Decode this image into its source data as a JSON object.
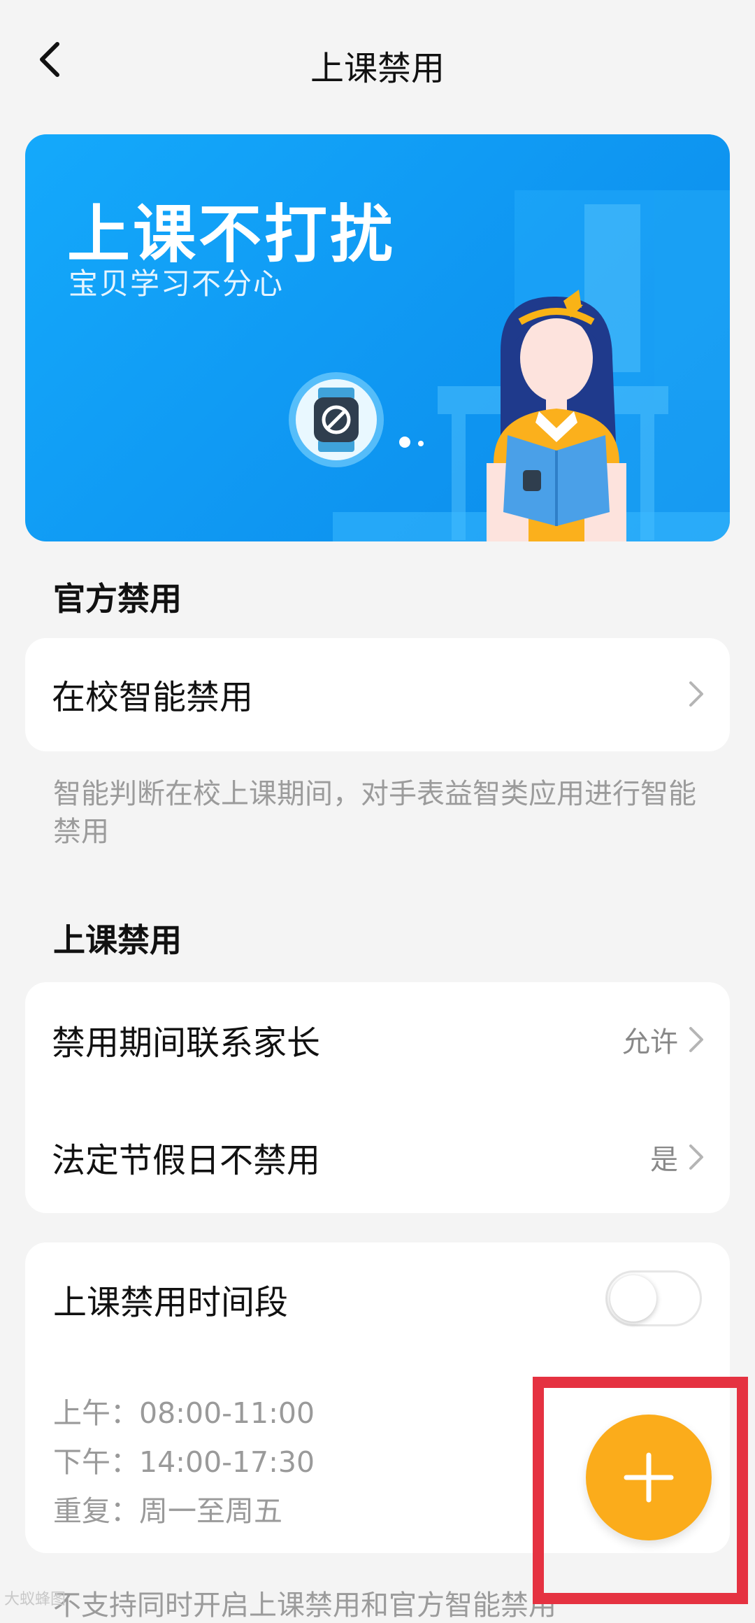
{
  "header": {
    "title": "上课禁用"
  },
  "banner": {
    "title": "上课不打扰",
    "subtitle": "宝贝学习不分心"
  },
  "official": {
    "section_title": "官方禁用",
    "item_label": "在校智能禁用",
    "description": "智能判断在校上课期间，对手表益智类应用进行智能禁用"
  },
  "class_disable": {
    "section_title": "上课禁用",
    "items": [
      {
        "label": "禁用期间联系家长",
        "value": "允许"
      },
      {
        "label": "法定节假日不禁用",
        "value": "是"
      }
    ]
  },
  "period": {
    "label": "上课禁用时间段",
    "enabled": false,
    "morning": "上午：08:00-11:00",
    "afternoon": "下午：14:00-17:30",
    "repeat": "重复：周一至周五"
  },
  "footer_note": "不支持同时开启上课禁用和官方智能禁用",
  "watermark": "大蚁蜂图",
  "colors": {
    "accent": "#fbac1b",
    "banner": "#14a9fb",
    "highlight": "#e53241"
  },
  "icons": {
    "back": "chevron-left-icon",
    "row_arrow": "chevron-right-icon",
    "fab": "plus-icon",
    "banner_badge": "watch-block-icon"
  }
}
